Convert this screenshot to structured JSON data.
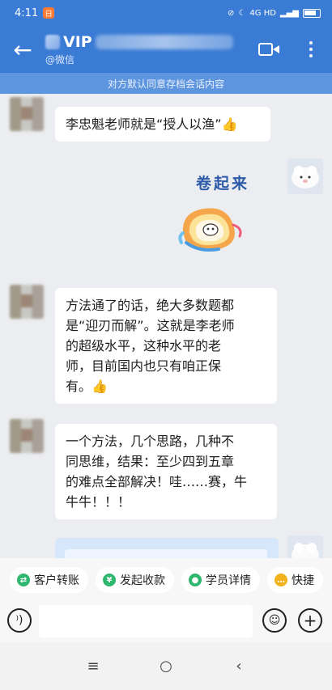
{
  "status": {
    "time": "4:11",
    "app_badge": "日",
    "network": "4G HD"
  },
  "header": {
    "title_suffix": "VIP",
    "subtitle": "@微信"
  },
  "notice": "对方默认同意存档会话内容",
  "messages": [
    {
      "side": "left",
      "text": "李忠魁老师就是“授人以渔”",
      "emoji": "👍"
    },
    {
      "side": "right",
      "sticker_text": "卷起来"
    },
    {
      "side": "left",
      "lines": [
        "方法通了的话，绝大多数题都",
        "是“迎刃而解”。这就是李老师",
        "的超级水平，这种水平的老",
        "师，目前国内也只有咱正保"
      ],
      "last_line": "有。",
      "emoji": "👍"
    },
    {
      "side": "left",
      "lines": [
        "一个方法，几个思路，几种不",
        "同思维，结果：至少四到五章",
        "的难点全部解决！哇……赛，牛",
        "牛牛！！！"
      ]
    }
  ],
  "quick_actions": [
    {
      "label": "客户转账",
      "icon": "⇄",
      "color": "#2fb66f"
    },
    {
      "label": "发起收款",
      "icon": "¥",
      "color": "#2fb66f"
    },
    {
      "label": "学员详情",
      "icon": "●",
      "color": "#2fb66f"
    },
    {
      "label": "快捷",
      "icon": "…",
      "color": "#f2b21b"
    }
  ],
  "input": {
    "placeholder": ""
  },
  "colors": {
    "header": "#3a7bd5",
    "notice": "#5e95df",
    "chat_bg": "#ebedf0"
  }
}
